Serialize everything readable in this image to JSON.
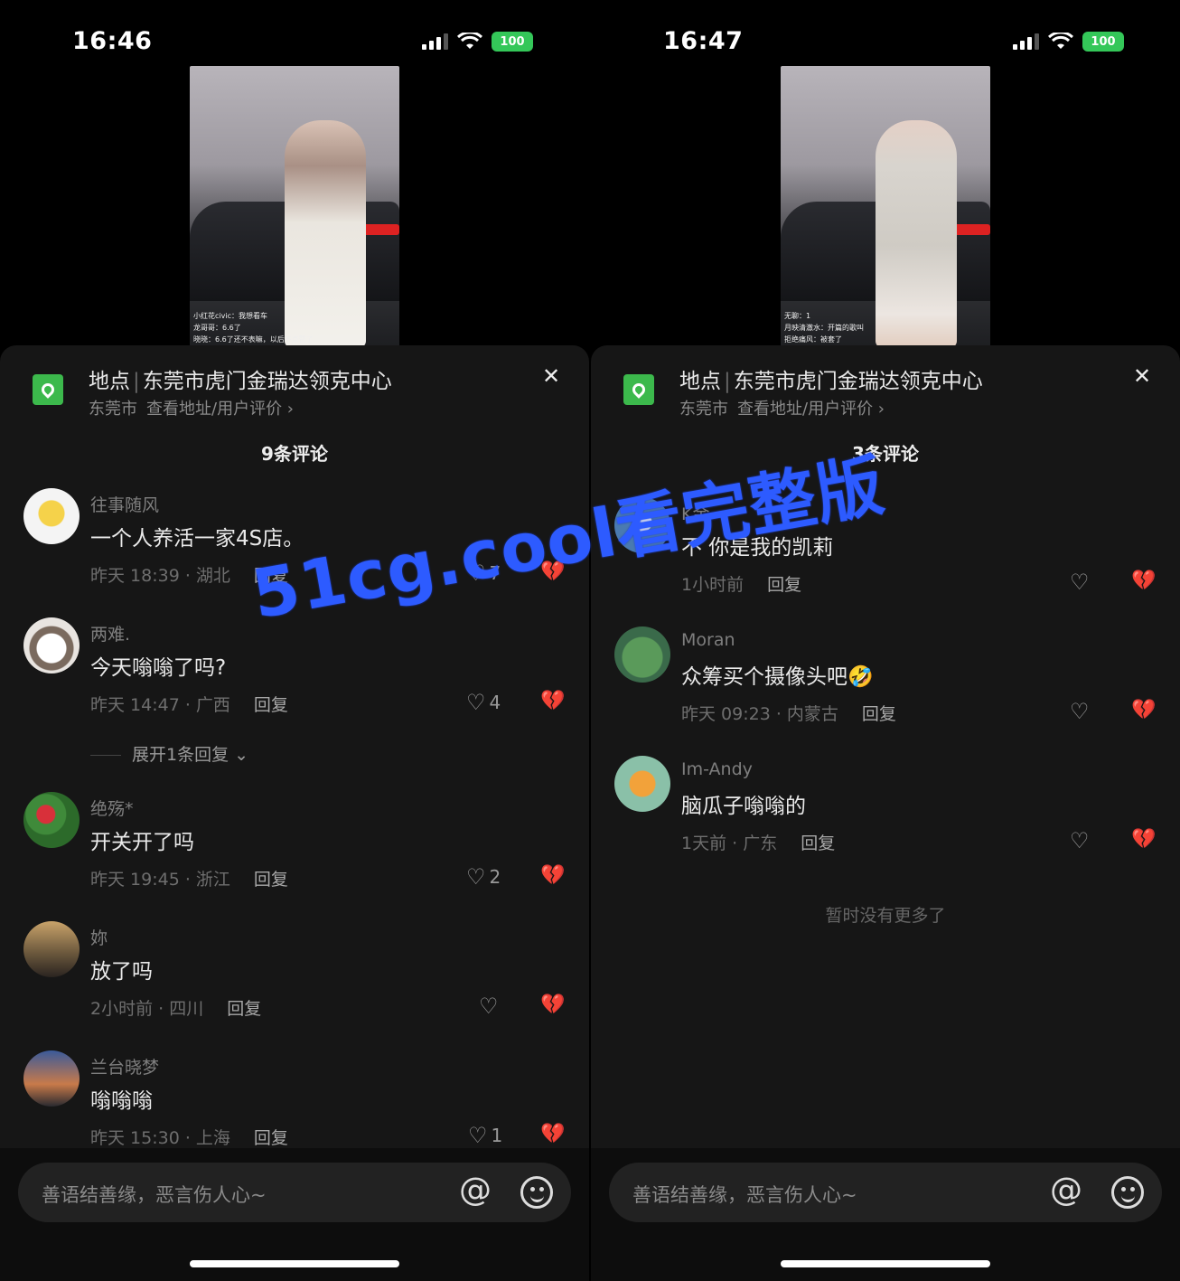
{
  "left": {
    "status": {
      "time": "16:46",
      "battery": "100"
    },
    "video_overlay": [
      "小红花civic：我想看车",
      "龙哥哥：6.6了",
      "晓晓：6.6了还不表嘛，以后不点赞了"
    ],
    "location": {
      "label": "地点",
      "name": "东莞市虎门金瑞达领克中心",
      "city": "东莞市",
      "link": "查看地址/用户评价 ›"
    },
    "comment_count": "9条评论",
    "comments": [
      {
        "name": "往事随风",
        "text": "一个人养活一家4S店。",
        "meta": "昨天 18:39 · 湖北",
        "reply": "回复",
        "likes": "7"
      },
      {
        "name": "两难.",
        "text": "今天嗡嗡了吗?",
        "meta": "昨天 14:47 · 广西",
        "reply": "回复",
        "likes": "4"
      },
      {
        "name": "绝殇*",
        "text": "开关开了吗",
        "meta": "昨天 19:45 · 浙江",
        "reply": "回复",
        "likes": "2"
      },
      {
        "name": "妳",
        "text": "放了吗",
        "meta": "2小时前 · 四川",
        "reply": "回复",
        "likes": ""
      },
      {
        "name": "兰台晓梦",
        "text": "嗡嗡嗡",
        "meta": "昨天 15:30 · 上海",
        "reply": "回复",
        "likes": "1"
      }
    ],
    "expand": "展开1条回复",
    "input_placeholder": "善语结善缘，恶言伤人心~"
  },
  "right": {
    "status": {
      "time": "16:47",
      "battery": "100"
    },
    "video_overlay": [
      "无聊：1",
      "月映清澈水：开篇的歌叫",
      "拒绝痛风：被套了"
    ],
    "location": {
      "label": "地点",
      "name": "东莞市虎门金瑞达领克中心",
      "city": "东莞市",
      "link": "查看地址/用户评价 ›"
    },
    "comment_count": "3条评论",
    "comments": [
      {
        "name": "K金",
        "text": "不 你是我的凯莉",
        "meta": "1小时前",
        "reply": "回复",
        "likes": ""
      },
      {
        "name": "Moran",
        "text": "众筹买个摄像头吧🤣",
        "meta": "昨天 09:23 · 内蒙古",
        "reply": "回复",
        "likes": ""
      },
      {
        "name": "Im-Andy",
        "text": "脑瓜子嗡嗡的",
        "meta": "1天前 · 广东",
        "reply": "回复",
        "likes": ""
      }
    ],
    "no_more": "暂时没有更多了",
    "input_placeholder": "善语结善缘，恶言伤人心~"
  },
  "watermark": "51cg.cool看完整版",
  "colors": {
    "accent_green": "#3cb94c",
    "battery_green": "#34c759",
    "watermark_blue": "#2d5bff",
    "sheet_bg": "#161616"
  }
}
